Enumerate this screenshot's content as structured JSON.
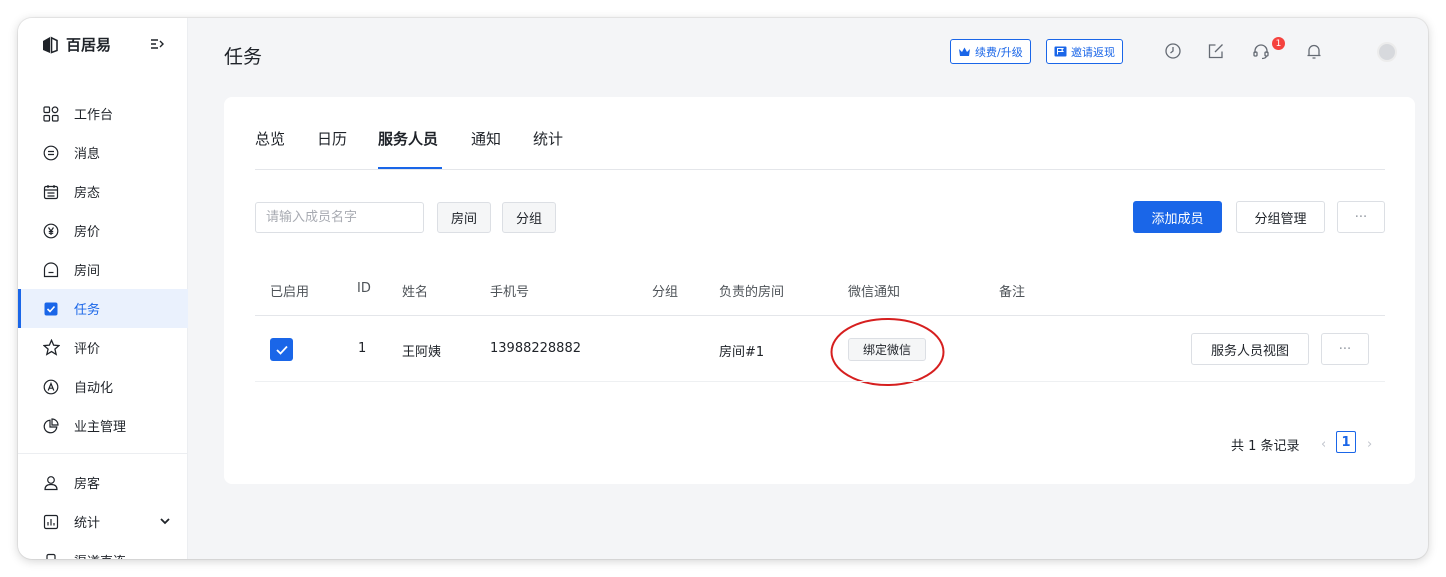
{
  "brand": {
    "name": "百居易"
  },
  "sidebar": {
    "items": [
      {
        "label": "工作台",
        "icon": "grid-icon"
      },
      {
        "label": "消息",
        "icon": "message-icon"
      },
      {
        "label": "房态",
        "icon": "calendar-icon"
      },
      {
        "label": "房价",
        "icon": "yen-icon"
      },
      {
        "label": "房间",
        "icon": "room-icon"
      },
      {
        "label": "任务",
        "icon": "checkbox-icon",
        "active": true
      },
      {
        "label": "评价",
        "icon": "star-icon"
      },
      {
        "label": "自动化",
        "icon": "automation-icon"
      },
      {
        "label": "业主管理",
        "icon": "pie-chart-icon"
      }
    ],
    "items2": [
      {
        "label": "房客",
        "icon": "user-icon"
      },
      {
        "label": "统计",
        "icon": "bar-chart-icon"
      },
      {
        "label": "渠道直连",
        "icon": "channel-icon"
      }
    ]
  },
  "header": {
    "title": "任务",
    "renew_label": "续费/升级",
    "invite_label": "邀请返现",
    "support_badge": "1"
  },
  "tabs": [
    "总览",
    "日历",
    "服务人员",
    "通知",
    "统计"
  ],
  "toolbar": {
    "search_placeholder": "请输入成员名字",
    "filter_room": "房间",
    "filter_group": "分组",
    "add_member": "添加成员",
    "group_manage": "分组管理",
    "more": "···"
  },
  "table": {
    "headers": [
      "已启用",
      "ID",
      "姓名",
      "手机号",
      "分组",
      "负责的房间",
      "微信通知",
      "备注"
    ],
    "rows": [
      {
        "enabled": true,
        "id": "1",
        "name": "王阿姨",
        "phone": "13988228882",
        "group": "",
        "rooms": "房间#1",
        "wechat_action": "绑定微信",
        "note": "",
        "view_action": "服务人员视图",
        "more": "···"
      }
    ]
  },
  "pagination": {
    "summary": "共 1 条记录",
    "current": "1",
    "prev": "‹",
    "next": "›"
  },
  "colors": {
    "accent": "#1a66e8",
    "annotation": "#d61f1f",
    "badge": "#f5423e"
  }
}
